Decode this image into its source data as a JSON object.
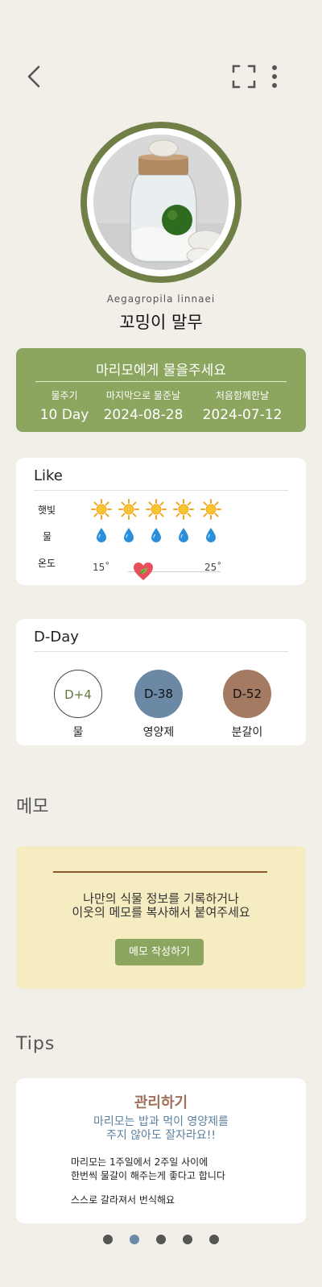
{
  "plant": {
    "scientific_name": "Aegagropila linnaei",
    "nickname": "꼬밍이 말무"
  },
  "water_card": {
    "title": "마리모에게 물을주세요",
    "columns": [
      {
        "label": "물주기",
        "value": "10 Day"
      },
      {
        "label": "마지막으로 물준날",
        "value": "2024-08-28"
      },
      {
        "label": "처음함께한날",
        "value": "2024-07-12"
      }
    ]
  },
  "like": {
    "title": "Like",
    "sunlight_label": "햇빛",
    "sunlight_level": 5,
    "water_label": "물",
    "water_level": 5,
    "temperature_label": "온도",
    "temp_min": "15˚",
    "temp_max": "25˚"
  },
  "dday": {
    "title": "D-Day",
    "items": [
      {
        "badge": "D+4",
        "label": "물",
        "color": "#ffffff"
      },
      {
        "badge": "D-38",
        "label": "영양제",
        "color": "#6b89a5"
      },
      {
        "badge": "D-52",
        "label": "분갈이",
        "color": "#a47a63"
      }
    ]
  },
  "memo": {
    "title": "메모",
    "text_line1": "나만의 식물 정보를 기록하거나",
    "text_line2": "이웃의 메모를 복사해서 붙여주세요",
    "button_label": "메모 작성하기"
  },
  "tips": {
    "title": "Tips",
    "card_title": "관리하기",
    "subtitle_line1": "마리모는 밥과 먹이 영양제를",
    "subtitle_line2": "주지 않아도 잘자라요!!",
    "body_line1": "마리모는 1주일에서 2주일 사이에",
    "body_line2": "한번씩 물갈이 해주는게 좋다고 합니다",
    "body_line3": "스스로 갈라져서 번식해요"
  },
  "pagination": {
    "count": 5,
    "active_index": 1
  },
  "colors": {
    "background": "#f1efe8",
    "accent_green": "#8ca65f",
    "ring_green": "#6f7f46",
    "memo_bg": "#f5ecc2",
    "sun": "#f5a623",
    "drop": "#2a8fd8"
  },
  "icons": [
    "back-icon",
    "expand-icon",
    "more-vertical-icon",
    "sun-icon",
    "water-drop-icon",
    "heart-leaf-icon"
  ]
}
